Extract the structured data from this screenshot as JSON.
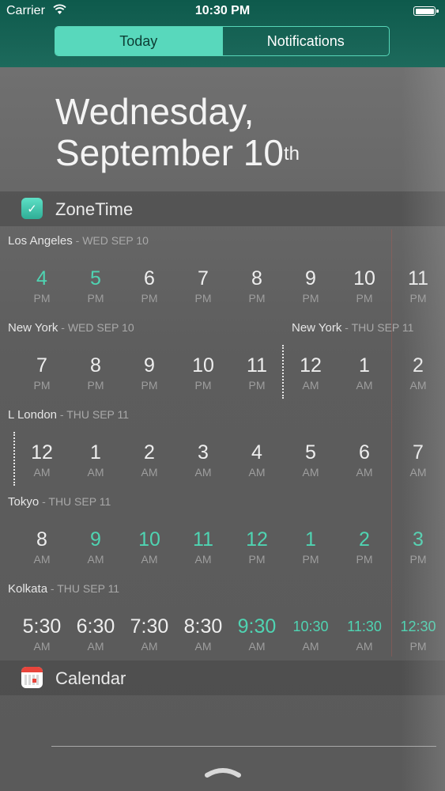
{
  "status": {
    "carrier": "Carrier",
    "time": "10:30 PM"
  },
  "tabs": {
    "today": "Today",
    "notifications": "Notifications"
  },
  "date": {
    "line1": "Wednesday,",
    "line2": "September 10",
    "suffix": "th"
  },
  "zonetime": {
    "title": "ZoneTime",
    "rows": [
      {
        "city": "Los Angeles",
        "date": "WED SEP 10",
        "hours": [
          {
            "v": "4",
            "ap": "PM",
            "teal": true
          },
          {
            "v": "5",
            "ap": "PM",
            "teal": true
          },
          {
            "v": "6",
            "ap": "PM"
          },
          {
            "v": "7",
            "ap": "PM"
          },
          {
            "v": "8",
            "ap": "PM"
          },
          {
            "v": "9",
            "ap": "PM"
          },
          {
            "v": "10",
            "ap": "PM"
          },
          {
            "v": "11",
            "ap": "PM"
          }
        ]
      },
      {
        "city": "New York",
        "date": "WED SEP 10",
        "city2": "New York",
        "date2": "THU SEP 11",
        "hours": [
          {
            "v": "7",
            "ap": "PM"
          },
          {
            "v": "8",
            "ap": "PM"
          },
          {
            "v": "9",
            "ap": "PM"
          },
          {
            "v": "10",
            "ap": "PM"
          },
          {
            "v": "11",
            "ap": "PM"
          },
          {
            "v": "12",
            "ap": "AM"
          },
          {
            "v": "1",
            "ap": "AM"
          },
          {
            "v": "2",
            "ap": "AM"
          }
        ]
      },
      {
        "city": "L  London",
        "date": "THU SEP 11",
        "hours": [
          {
            "v": "12",
            "ap": "AM"
          },
          {
            "v": "1",
            "ap": "AM"
          },
          {
            "v": "2",
            "ap": "AM"
          },
          {
            "v": "3",
            "ap": "AM"
          },
          {
            "v": "4",
            "ap": "AM"
          },
          {
            "v": "5",
            "ap": "AM"
          },
          {
            "v": "6",
            "ap": "AM"
          },
          {
            "v": "7",
            "ap": "AM"
          }
        ]
      },
      {
        "city": "Tokyo",
        "date": "THU SEP 11",
        "hours": [
          {
            "v": "8",
            "ap": "AM"
          },
          {
            "v": "9",
            "ap": "AM",
            "teal": true
          },
          {
            "v": "10",
            "ap": "AM",
            "teal": true
          },
          {
            "v": "11",
            "ap": "AM",
            "teal": true
          },
          {
            "v": "12",
            "ap": "PM",
            "teal": true
          },
          {
            "v": "1",
            "ap": "PM",
            "teal": true
          },
          {
            "v": "2",
            "ap": "PM",
            "teal": true
          },
          {
            "v": "3",
            "ap": "PM",
            "teal": true
          }
        ]
      },
      {
        "city": "Kolkata",
        "date": "THU SEP 11",
        "hours": [
          {
            "v": "5:30",
            "ap": "AM"
          },
          {
            "v": "6:30",
            "ap": "AM"
          },
          {
            "v": "7:30",
            "ap": "AM"
          },
          {
            "v": "8:30",
            "ap": "AM"
          },
          {
            "v": "9:30",
            "ap": "AM",
            "teal": true
          },
          {
            "v": "10:30",
            "ap": "AM",
            "teal": true,
            "small": true
          },
          {
            "v": "11:30",
            "ap": "AM",
            "teal": true,
            "small": true
          },
          {
            "v": "12:30",
            "ap": "PM",
            "teal": true,
            "small": true
          }
        ]
      }
    ]
  },
  "calendar": {
    "title": "Calendar"
  },
  "icons": {
    "wifi": "wifi-icon",
    "check": "check-icon",
    "grabber": "grabber-icon"
  }
}
